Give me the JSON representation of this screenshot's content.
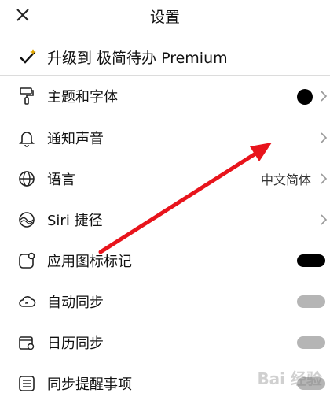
{
  "header": {
    "title": "设置",
    "close_icon": "close-icon"
  },
  "premium": {
    "label": "升级到 极简待办 Premium",
    "icon": "checkmark-sparkle-icon"
  },
  "settings": {
    "theme_font": {
      "label": "主题和字体",
      "icon": "paint-roller-icon"
    },
    "notification_sound": {
      "label": "通知声音",
      "icon": "bell-icon"
    },
    "language": {
      "label": "语言",
      "value": "中文简体",
      "icon": "globe-icon"
    },
    "siri": {
      "label": "Siri 捷径",
      "icon": "siri-icon"
    },
    "app_badge": {
      "label": "应用图标标记",
      "icon": "app-badge-icon",
      "toggle": "on"
    },
    "auto_sync": {
      "label": "自动同步",
      "icon": "cloud-sync-icon",
      "toggle": "off"
    },
    "calendar_sync": {
      "label": "日历同步",
      "icon": "calendar-sync-icon",
      "toggle": "off"
    },
    "reminder_sync": {
      "label": "同步提醒事项",
      "icon": "list-icon",
      "toggle": "off"
    }
  },
  "colors": {
    "accent": "#e8141c",
    "dark": "#000000",
    "toggle_off": "#b5b5b5"
  },
  "watermark": "Bai 经验"
}
